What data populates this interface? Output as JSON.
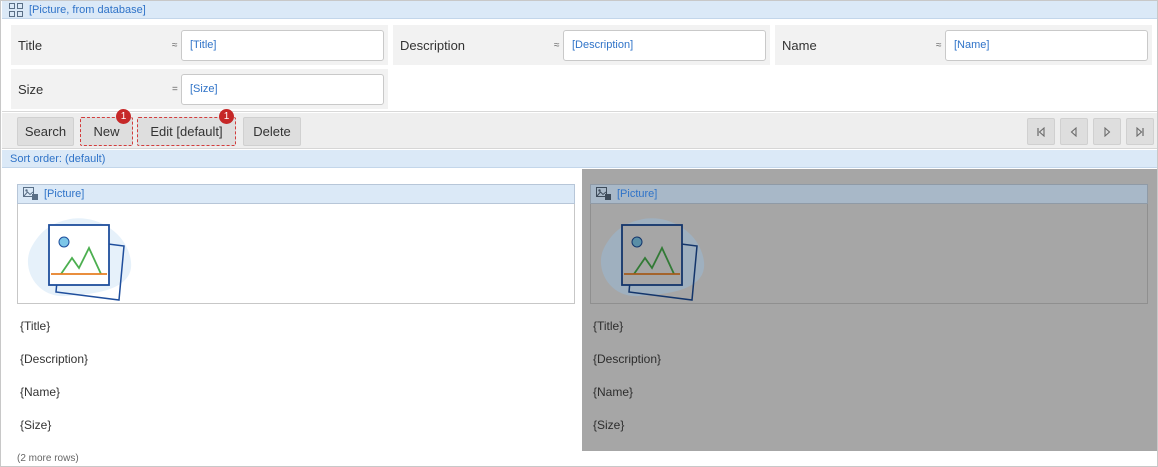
{
  "title_bar": {
    "icon": "grid-icon",
    "text": "[Picture, from database]"
  },
  "filters": [
    {
      "label": "Title",
      "operator": "≈",
      "value": "[Title]"
    },
    {
      "label": "Description",
      "operator": "≈",
      "value": "[Description]"
    },
    {
      "label": "Name",
      "operator": "≈",
      "value": "[Name]"
    },
    {
      "label": "Size",
      "operator": "=",
      "value": "[Size]"
    }
  ],
  "toolbar": {
    "search_label": "Search",
    "new_label": "New",
    "new_badge": "1",
    "edit_label": "Edit [default]",
    "edit_badge": "1",
    "delete_label": "Delete",
    "nav_icons": [
      "first-page-icon",
      "previous-page-icon",
      "next-page-icon",
      "last-page-icon"
    ]
  },
  "sort_order": "Sort order: (default)",
  "cards": [
    {
      "picture_label": "[Picture]",
      "title": "{Title}",
      "description": "{Description}",
      "name": "{Name}",
      "size": "{Size}",
      "selected": false
    },
    {
      "picture_label": "[Picture]",
      "title": "{Title}",
      "description": "{Description}",
      "name": "{Name}",
      "size": "{Size}",
      "selected": true
    }
  ],
  "more_rows": "(2 more rows)",
  "colors": {
    "accent_text": "#2f73c8",
    "header_bg": "#dbe9f7",
    "badge": "#c62828",
    "selected_card": "#a6a6a6"
  }
}
